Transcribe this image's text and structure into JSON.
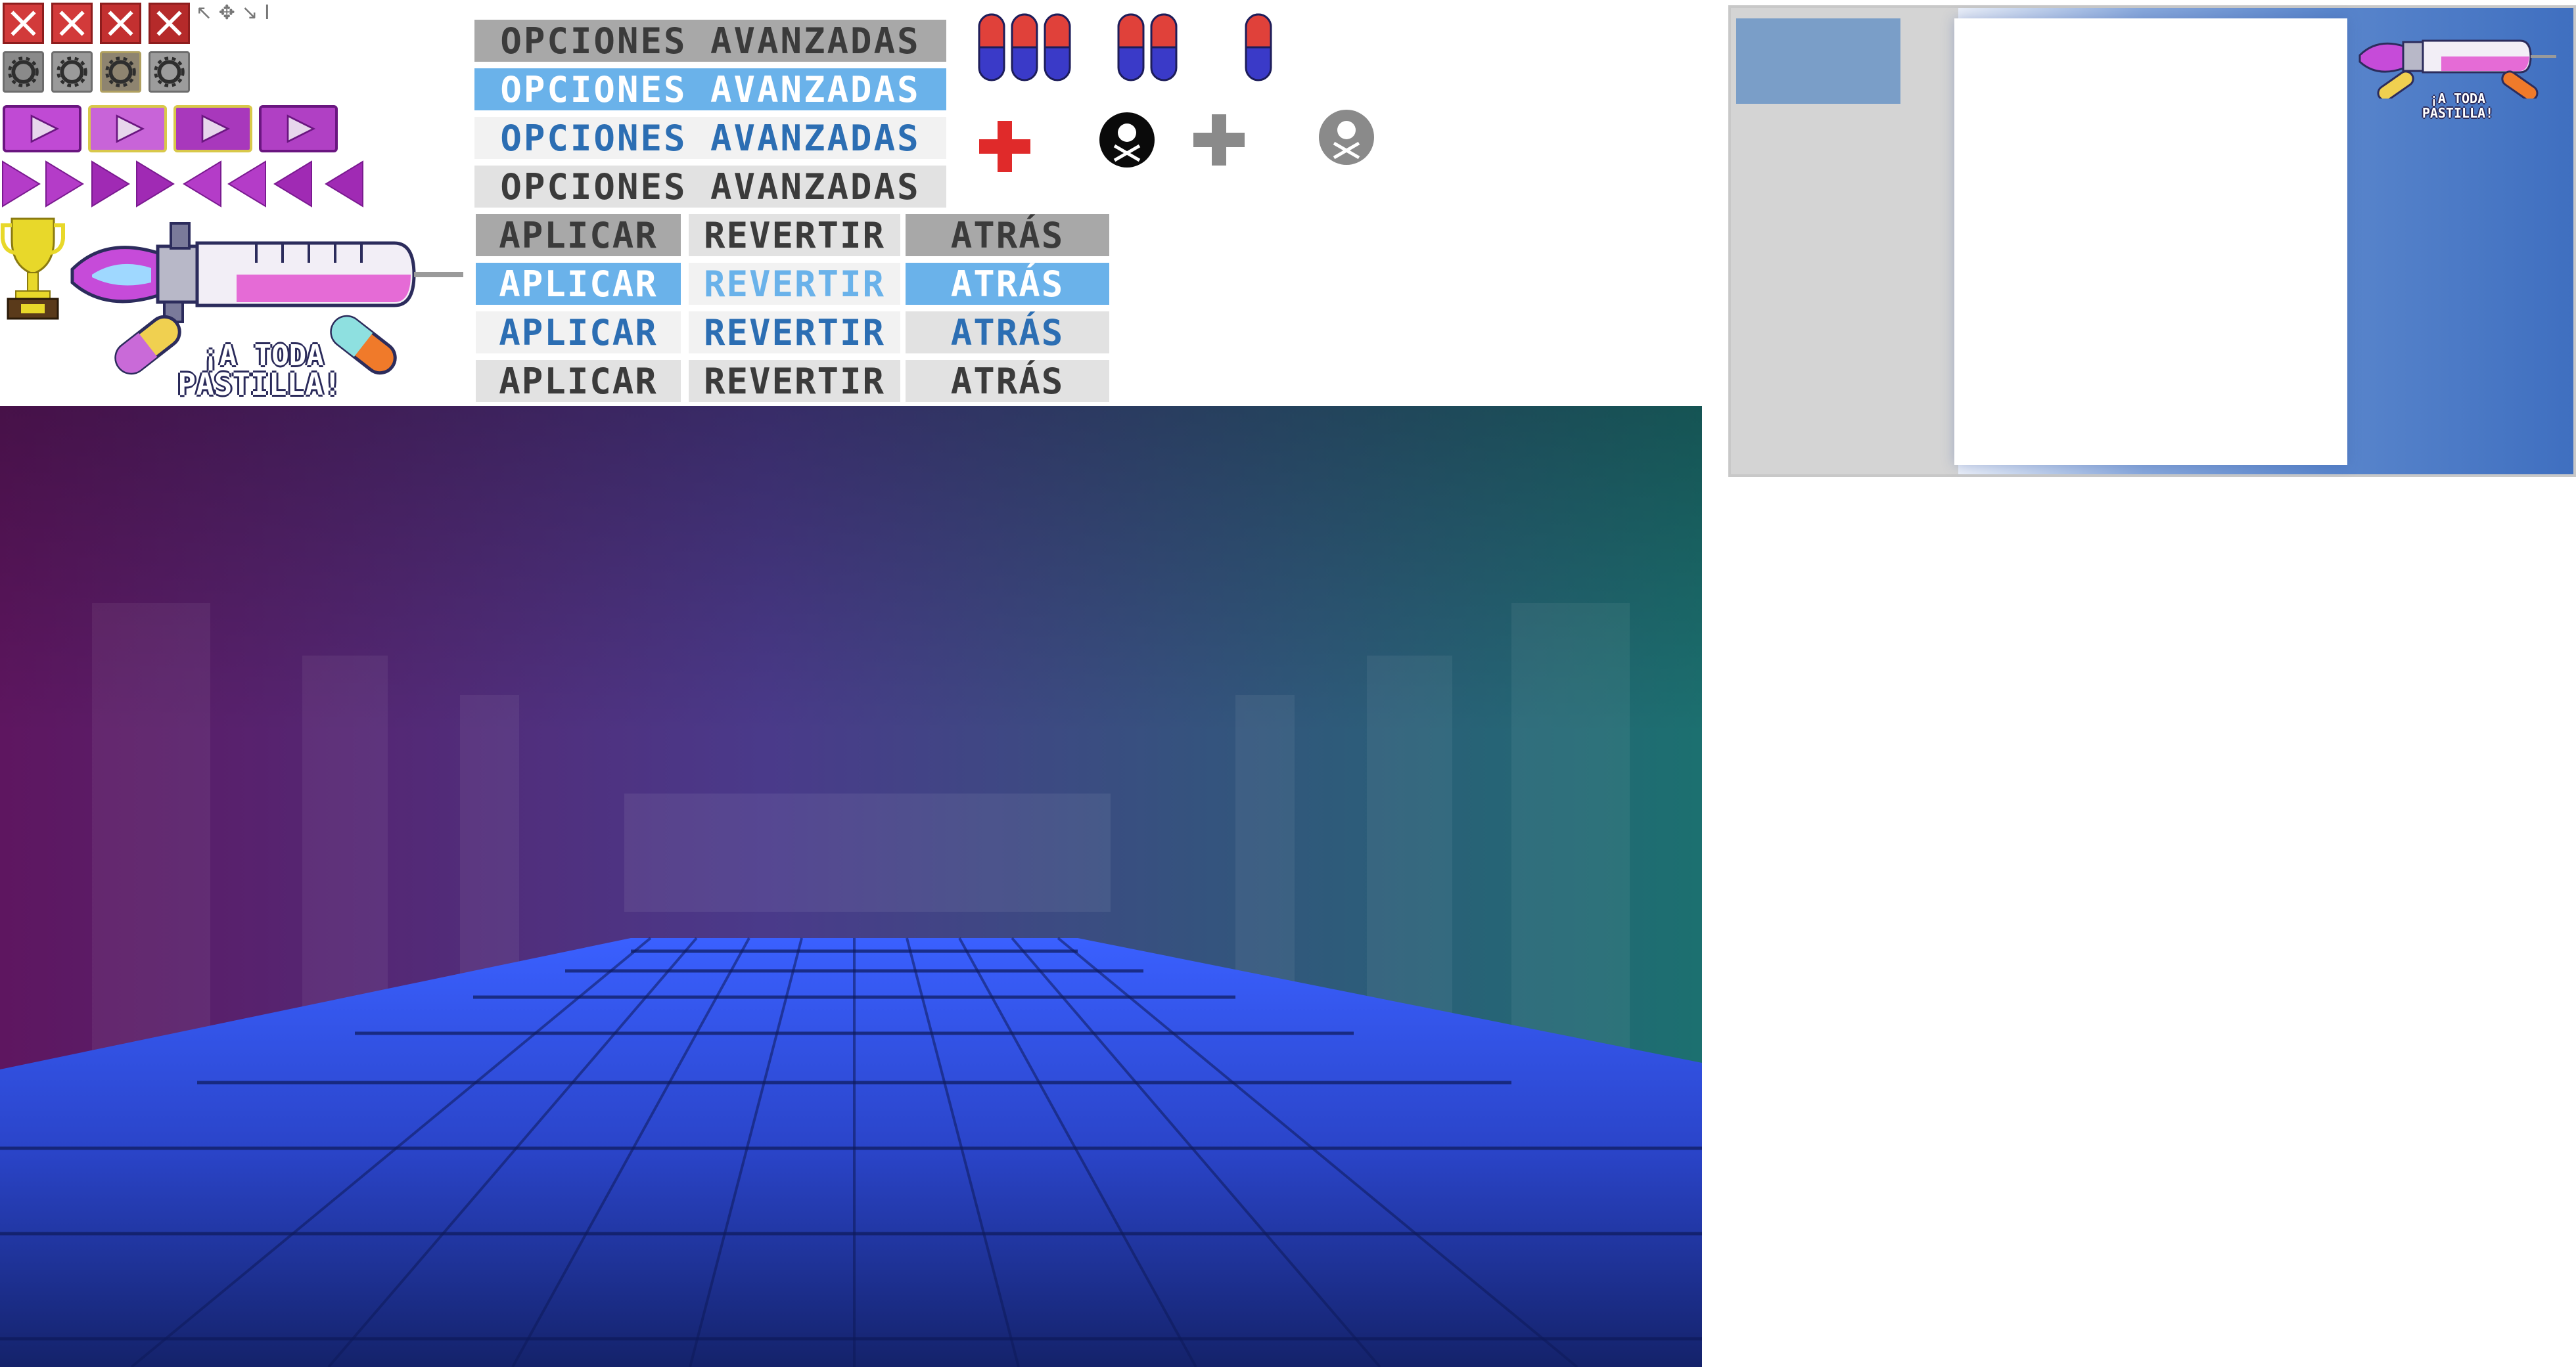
{
  "atlas": {
    "cursor_glyphs": "↖ ✥ ↘ I",
    "close_icons": [
      {
        "name": "close-icon-normal"
      },
      {
        "name": "close-icon-hover"
      },
      {
        "name": "close-icon-pressed"
      },
      {
        "name": "close-icon-dim"
      }
    ],
    "gear_icons": [
      {
        "name": "gear-icon-normal"
      },
      {
        "name": "gear-icon-hover"
      },
      {
        "name": "gear-icon-pressed"
      },
      {
        "name": "gear-icon-dim"
      }
    ],
    "advanced_options": [
      {
        "label": "OPCIONES AVANZADAS",
        "state": "normal"
      },
      {
        "label": "OPCIONES AVANZADAS",
        "state": "hover"
      },
      {
        "label": "OPCIONES AVANZADAS",
        "state": "pressed"
      },
      {
        "label": "OPCIONES AVANZADAS",
        "state": "disabled"
      }
    ],
    "apply_buttons": [
      "APLICAR",
      "APLICAR",
      "APLICAR",
      "APLICAR"
    ],
    "revert_buttons": [
      "REVERTIR",
      "REVERTIR",
      "REVERTIR",
      "REVERTIR"
    ],
    "back_buttons": [
      "ATRÁS",
      "ATRÁS",
      "ATRÁS",
      "ATRÁS"
    ],
    "logo": {
      "line1": "¡A TODA",
      "line2": "PASTILLA!"
    },
    "preview_logo": {
      "line1": "¡A TODA",
      "line2": "PASTILLA!"
    }
  },
  "colors": {
    "close_red": "#d23a3a",
    "play_purple": "#b43cc8",
    "pill_red": "#e0413a",
    "pill_blue": "#3a3ac8",
    "state_gray": "#a8a8a8",
    "state_blue": "#6ab2ea",
    "text_blue": "#2c6eb3",
    "bg_purple": "#5a1a5a",
    "bg_teal": "#1a6a6a",
    "floor_blue": "#2a4ad8"
  }
}
